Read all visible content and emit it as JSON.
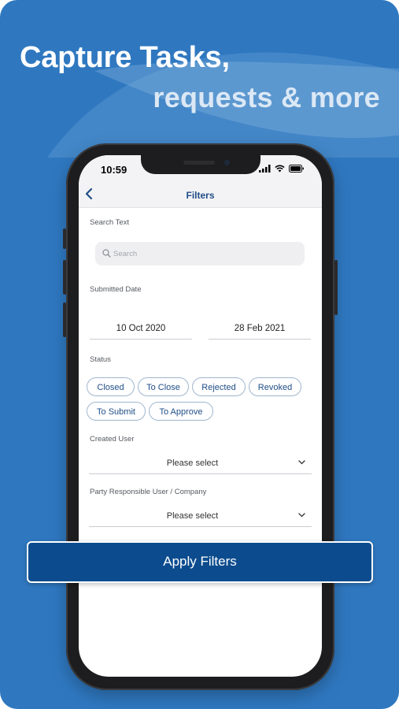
{
  "promo": {
    "headline_line1": "Capture Tasks,",
    "headline_line2": "requests & more"
  },
  "colors": {
    "background": "#2f78c0",
    "brand_dark": "#0c4c8e",
    "accent_text": "#1f4e86"
  },
  "status_bar": {
    "time": "10:59",
    "icons": [
      "signal-icon",
      "wifi-icon",
      "battery-icon"
    ]
  },
  "nav": {
    "back_icon": "chevron-left-icon",
    "title": "Filters"
  },
  "filters": {
    "search": {
      "label": "Search Text",
      "placeholder": "Search",
      "icon": "search-icon"
    },
    "submitted_date": {
      "label": "Submitted Date",
      "from": "10 Oct 2020",
      "to": "28 Feb 2021"
    },
    "status": {
      "label": "Status",
      "chips": [
        "Closed",
        "To Close",
        "Rejected",
        "Revoked",
        "To Submit",
        "To Approve"
      ]
    },
    "created_user": {
      "label": "Created User",
      "value": "Please select"
    },
    "party_responsible": {
      "label": "Party Responsible User / Company",
      "value": "Please select"
    }
  },
  "apply_button": {
    "label": "Apply Filters"
  }
}
